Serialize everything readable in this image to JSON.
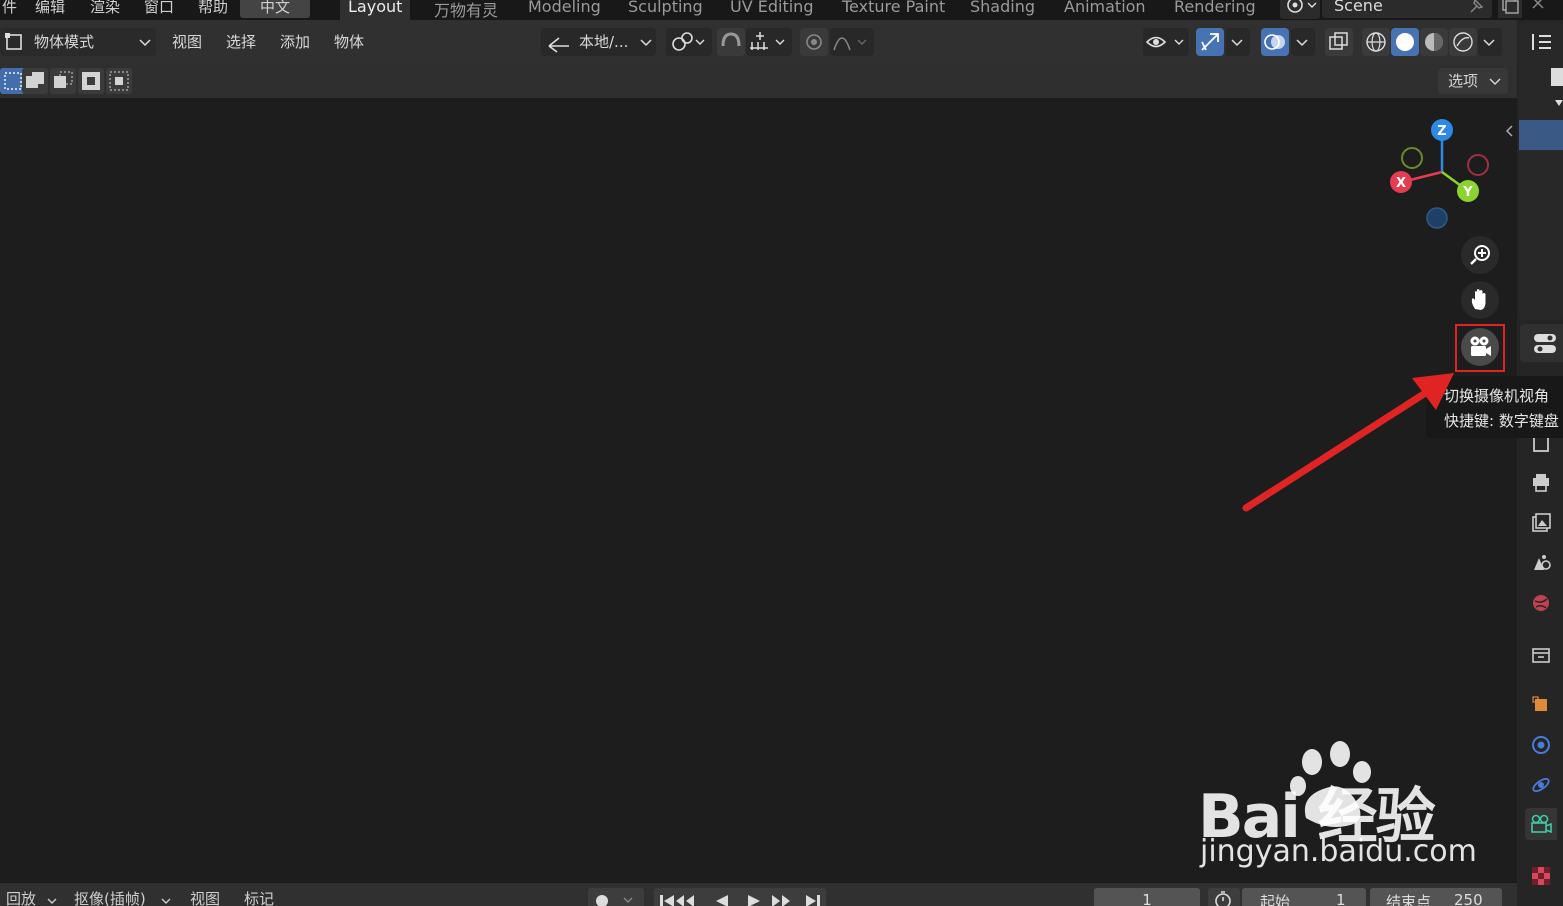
{
  "menubar": {
    "items": [
      "件",
      "编辑",
      "渲染",
      "窗口",
      "帮助"
    ],
    "language": "中文",
    "workspaces": [
      "Layout",
      "万物有灵",
      "Modeling",
      "Sculpting",
      "UV Editing",
      "Texture Paint",
      "Shading",
      "Animation",
      "Rendering"
    ],
    "active_workspace": "Layout",
    "scene": "Scene"
  },
  "header": {
    "mode": "物体模式",
    "menus": [
      "视图",
      "选择",
      "添加",
      "物体"
    ],
    "transform_orientation": "本地/...",
    "options": "选项"
  },
  "tooltip": {
    "title": "切换摄像机视角",
    "shortcut": "快捷键: 数字键盘"
  },
  "gizmo": {
    "x": "X",
    "y": "Y",
    "z": "Z"
  },
  "timeline": {
    "playback": "回放",
    "keying": "抠像(插帧)",
    "view": "视图",
    "marker": "标记",
    "current_frame": "1",
    "start_label": "起始",
    "start_value": "1",
    "end_label": "结束点",
    "end_value": "250"
  },
  "watermark": {
    "brand": "Bai   经验",
    "url": "jingyan.baidu.com"
  },
  "colors": {
    "accent": "#4772b3",
    "x_axis": "#e63c52",
    "y_axis": "#8bd32e",
    "z_axis": "#2d88e6",
    "camera_frame": "#e6a23c",
    "annotation_red": "#e02424"
  }
}
